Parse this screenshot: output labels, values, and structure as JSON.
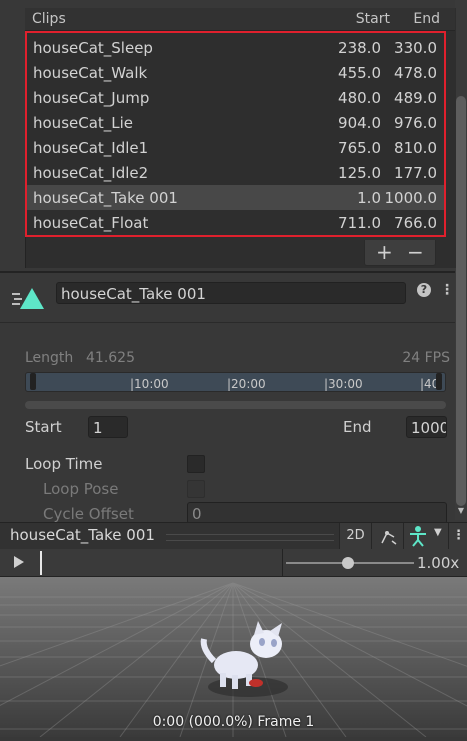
{
  "clips": {
    "header": {
      "name": "Clips",
      "start": "Start",
      "end": "End"
    },
    "items": [
      {
        "name": "houseCat_Sleep",
        "start": "238.0",
        "end": "330.0"
      },
      {
        "name": "houseCat_Walk",
        "start": "455.0",
        "end": "478.0"
      },
      {
        "name": "houseCat_Jump",
        "start": "480.0",
        "end": "489.0"
      },
      {
        "name": "houseCat_Lie",
        "start": "904.0",
        "end": "976.0"
      },
      {
        "name": "houseCat_Idle1",
        "start": "765.0",
        "end": "810.0"
      },
      {
        "name": "houseCat_Idle2",
        "start": "125.0",
        "end": "177.0"
      },
      {
        "name": "houseCat_Take 001",
        "start": "1.0",
        "end": "1000.0"
      },
      {
        "name": "houseCat_Float",
        "start": "711.0",
        "end": "766.0"
      }
    ],
    "selected_index": 6,
    "add_label": "+",
    "remove_label": "−"
  },
  "clip_settings": {
    "name_value": "houseCat_Take 001",
    "help_label": "?",
    "menu_label": "⋮",
    "length_label": "Length",
    "length_value": "41.625",
    "fps": "24 FPS",
    "ticks": [
      "|10:00",
      "|20:00",
      "|30:00",
      "|40"
    ],
    "start_label": "Start",
    "start_value": "1",
    "end_label": "End",
    "end_value": "1000",
    "loop_time_label": "Loop Time",
    "loop_pose_label": "Loop Pose",
    "cycle_offset_label": "Cycle Offset",
    "cycle_offset_value": "0"
  },
  "preview": {
    "title": "houseCat_Take 001",
    "btn_2d": "2D",
    "menu_label": "⋮",
    "speed": "1.00x",
    "speed_fraction": 0.45,
    "frame_label": "0:00 (000.0%) Frame 1"
  },
  "colors": {
    "highlight_border": "#e0202d",
    "accent_icon": "#5ee6c8"
  },
  "icons": [
    "clip-icon",
    "help-icon",
    "menu-icon",
    "play-icon",
    "pivot-icon",
    "avatar-icon",
    "chevron-down-icon"
  ]
}
